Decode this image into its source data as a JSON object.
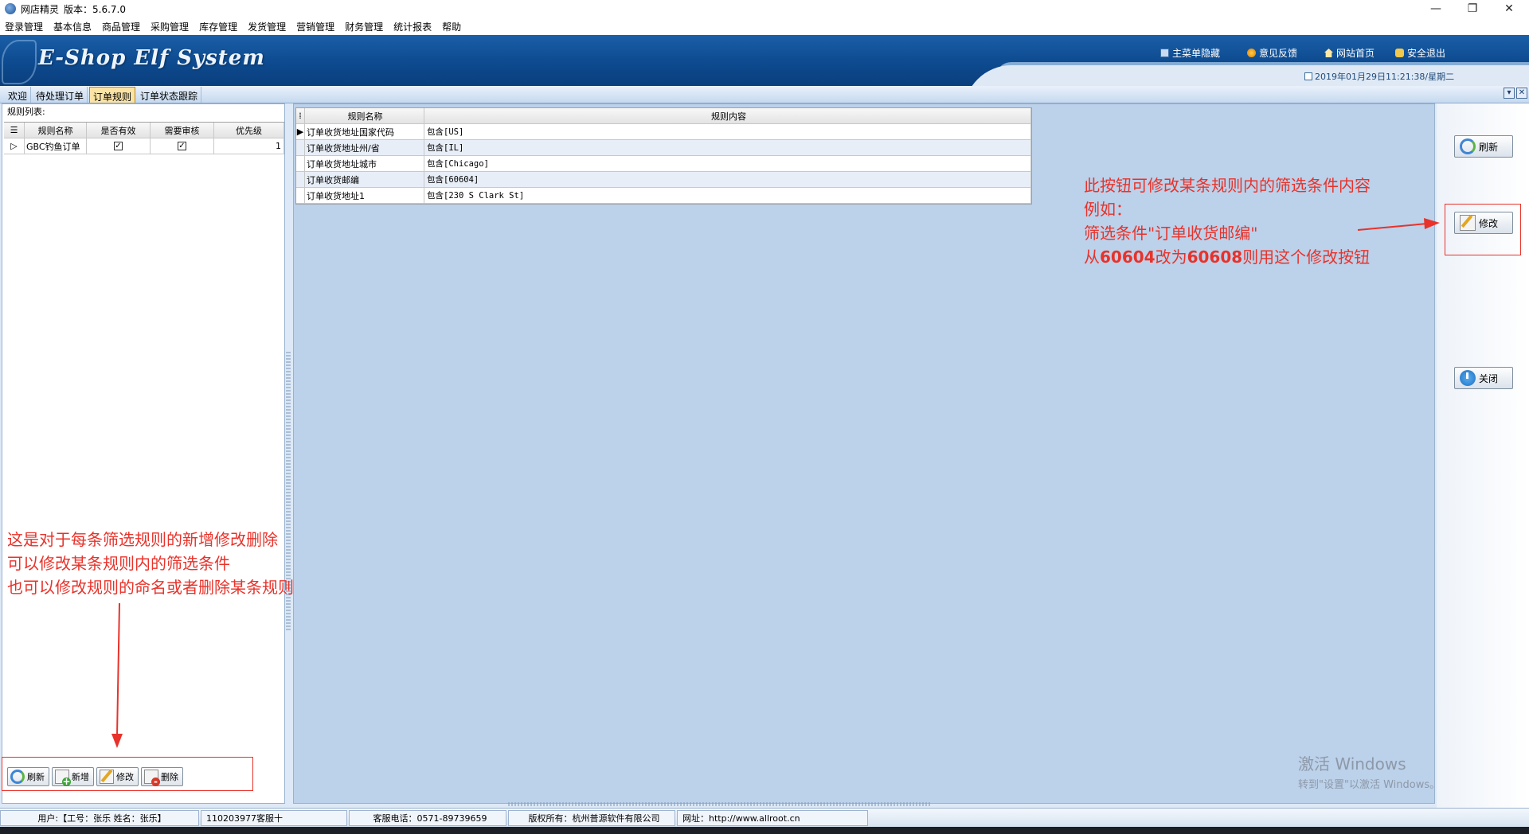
{
  "window": {
    "title": "网店精灵",
    "version": "版本：5.6.7.0",
    "controls": {
      "minimize": "—",
      "maximize": "❐",
      "close": "✕"
    }
  },
  "menu": [
    "登录管理",
    "基本信息",
    "商品管理",
    "采购管理",
    "库存管理",
    "发货管理",
    "营销管理",
    "财务管理",
    "统计报表",
    "帮助"
  ],
  "banner": {
    "logo": "E-Shop Elf System",
    "links": {
      "hide_menu": "主菜单隐藏",
      "feedback": "意见反馈",
      "home": "网站首页",
      "exit": "安全退出"
    },
    "datetime": "2019年01月29日11:21:38/星期二"
  },
  "tabs": [
    "欢迎",
    "待处理订单",
    "订单规则",
    "订单状态跟踪"
  ],
  "active_tab": "订单规则",
  "tab_strip_buttons": {
    "dropdown": "▾",
    "close": "✕"
  },
  "left_panel": {
    "title": "规则列表:",
    "columns": [
      "规则名称",
      "是否有效",
      "需要审核",
      "优先级"
    ],
    "rows": [
      {
        "indicator": "▷",
        "name": "GBC钓鱼订单",
        "valid": "✓",
        "review": "✓",
        "priority": "1"
      }
    ],
    "buttons": {
      "refresh": "刷新",
      "add": "新增",
      "edit": "修改",
      "delete": "删除"
    }
  },
  "right_grid": {
    "columns": [
      "规则名称",
      "规则内容"
    ],
    "rows": [
      {
        "indicator": "▶",
        "name": "订单收货地址国家代码",
        "content": "包含[US]"
      },
      {
        "indicator": "",
        "name": "订单收货地址州/省",
        "content": "包含[IL]"
      },
      {
        "indicator": "",
        "name": "订单收货地址城市",
        "content": "包含[Chicago]"
      },
      {
        "indicator": "",
        "name": "订单收货邮编",
        "content": "包含[60604]"
      },
      {
        "indicator": "",
        "name": "订单收货地址1",
        "content": "包含[230 S Clark St]"
      }
    ]
  },
  "action_panel": {
    "refresh": "刷新",
    "edit": "修改",
    "close": "关闭"
  },
  "annotations": {
    "left": [
      "这是对于每条筛选规则的新增修改删除",
      "可以修改某条规则内的筛选条件",
      "也可以修改规则的命名或者删除某条规则"
    ],
    "right_line1": "此按钮可修改某条规则内的筛选条件内容",
    "right_line2": "例如：",
    "right_line3": "筛选条件\"订单收货邮编\"",
    "right_line4_a": "从",
    "right_line4_b": "60604",
    "right_line4_c": "改为",
    "right_line4_d": "60608",
    "right_line4_e": "则用这个修改按钮",
    "color": "#e8322a"
  },
  "watermark": {
    "line1": "激活 Windows",
    "line2": "转到\"设置\"以激活 Windows。"
  },
  "statusbar": {
    "user": "用户:【工号：张乐   姓名：张乐】",
    "dept": "110203977客服十",
    "phone": "客服电话：0571-89739659",
    "copyright": "版权所有：杭州普源软件有限公司",
    "url": "网址：http://www.allroot.cn"
  }
}
